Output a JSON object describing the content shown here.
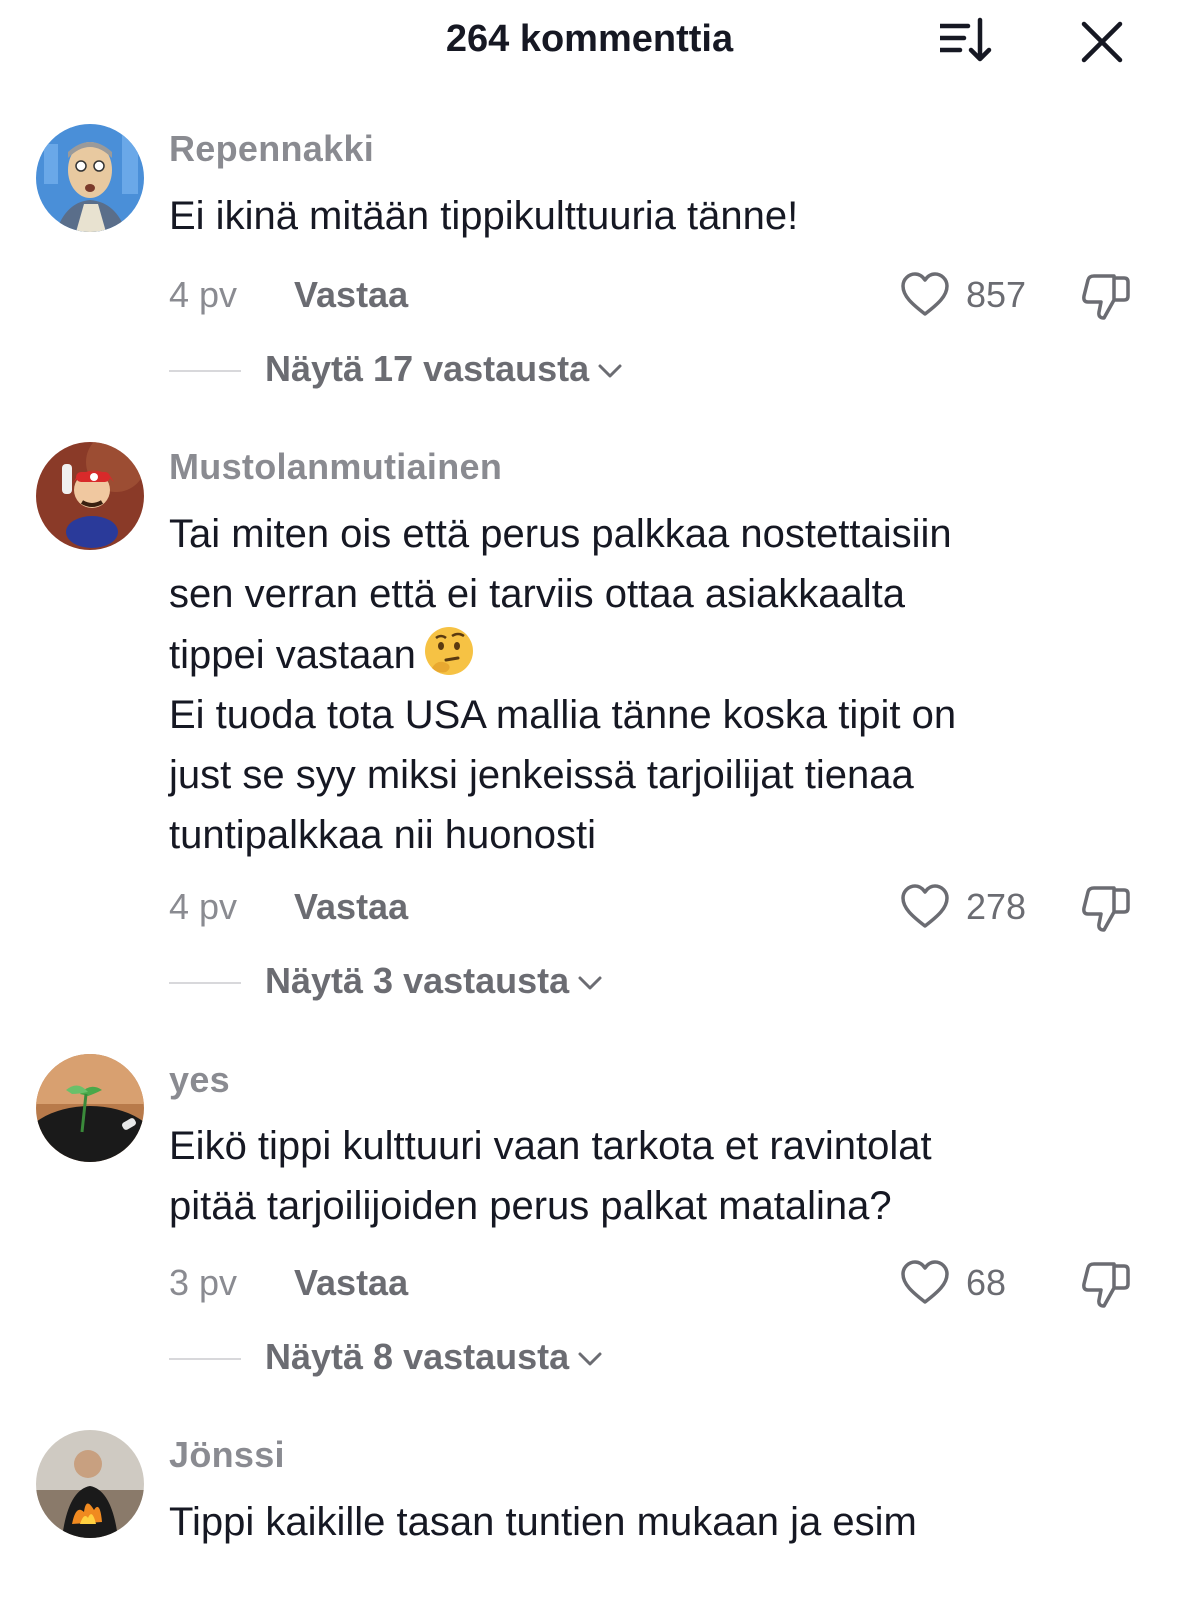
{
  "header": {
    "title": "264 kommenttia",
    "sort_icon": "sort-descending-icon",
    "close_icon": "close-icon"
  },
  "comments": [
    {
      "username": "Repennakki",
      "text": "Ei ikinä mitään tippikulttuuria tänne!",
      "date": "4 pv",
      "reply_label": "Vastaa",
      "likes": "857",
      "replies_label": "Näytä 17 vastausta",
      "avatar": "cartoon-man-avatar"
    },
    {
      "username": "Mustolanmutiainen",
      "text_before_emoji": "Tai miten ois että perus palkkaa nostettaisiin\nsen verran että ei tarviis ottaa asiakkaalta\ntippei vastaan",
      "emoji": "thinking-face-emoji",
      "text_after_emoji": "Ei tuoda tota USA mallia tänne koska tipit on\njust se syy miksi jenkeissä tarjoilijat tienaa\ntuntipalkkaa nii huonosti",
      "date": "4 pv",
      "reply_label": "Vastaa",
      "likes": "278",
      "replies_label": "Näytä 3 vastausta",
      "avatar": "mario-avatar"
    },
    {
      "username": "yes",
      "text": "Eikö tippi kulttuuri vaan tarkota et ravintolat\npitää tarjoilijoiden perus palkat matalina?",
      "date": "3 pv",
      "reply_label": "Vastaa",
      "likes": "68",
      "replies_label": "Näytä 8 vastausta",
      "avatar": "plant-sunset-avatar"
    },
    {
      "username": "Jönssi",
      "text": "Tippi kaikille tasan tuntien mukaan ja esim",
      "avatar": "chef-flame-avatar"
    }
  ],
  "colors": {
    "primary_text": "#161823",
    "secondary_text": "#8a8b91",
    "icon_gray": "#6b6c72"
  }
}
